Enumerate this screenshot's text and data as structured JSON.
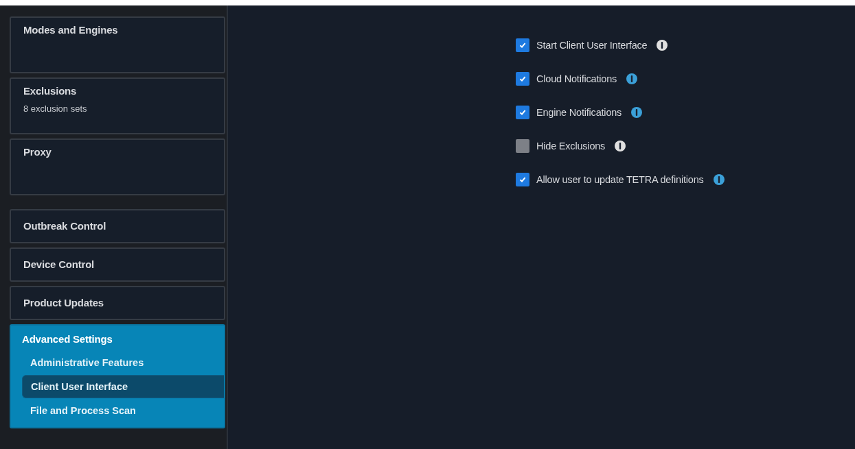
{
  "sidebar": {
    "groups": [
      {
        "kind": "tall",
        "items": [
          {
            "label": "Modes and Engines",
            "selected": false
          },
          {
            "label": "Exclusions",
            "subtitle": "8 exclusion sets",
            "selected": false
          },
          {
            "label": "Proxy",
            "selected": false
          }
        ]
      },
      {
        "kind": "short",
        "items": [
          {
            "label": "Outbreak Control",
            "selected": false
          },
          {
            "label": "Device Control",
            "selected": false
          },
          {
            "label": "Product Updates",
            "selected": false
          },
          {
            "label": "Advanced Settings",
            "selected": true,
            "expanded": true,
            "children": [
              {
                "label": "Administrative Features",
                "selected": false
              },
              {
                "label": "Client User Interface",
                "selected": true
              },
              {
                "label": "File and Process Scan",
                "selected": false
              }
            ]
          }
        ]
      }
    ]
  },
  "options": [
    {
      "label": "Start Client User Interface",
      "checked": true,
      "color": "#e0e0e0"
    },
    {
      "label": "Cloud Notifications",
      "checked": true,
      "color": "#3ba0d8"
    },
    {
      "label": "Engine Notifications",
      "checked": true,
      "color": "#3ba0d8"
    },
    {
      "label": "Hide Exclusions",
      "checked": false,
      "color": "#e0e0e0"
    },
    {
      "label": "Allow user to update TETRA definitions",
      "checked": true,
      "color": "#3ba0d8"
    }
  ]
}
